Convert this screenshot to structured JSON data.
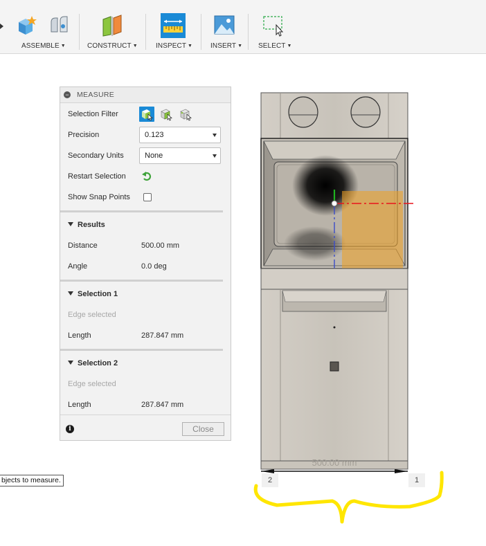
{
  "toolbar": {
    "groups": [
      {
        "label": "ASSEMBLE",
        "icon": "assemble-icon"
      },
      {
        "label": "CONSTRUCT",
        "icon": "construct-plane-icon"
      },
      {
        "label": "INSPECT",
        "icon": "measure-ruler-icon",
        "active": true
      },
      {
        "label": "INSERT",
        "icon": "insert-image-icon"
      },
      {
        "label": "SELECT",
        "icon": "select-window-icon"
      }
    ]
  },
  "measure": {
    "title": "MEASURE",
    "selection_filter_label": "Selection Filter",
    "precision_label": "Precision",
    "precision_value": "0.123",
    "secondary_units_label": "Secondary Units",
    "secondary_units_value": "None",
    "restart_selection_label": "Restart Selection",
    "show_snap_points_label": "Show Snap Points",
    "results": {
      "title": "Results",
      "distance_label": "Distance",
      "distance_value": "500.00 mm",
      "angle_label": "Angle",
      "angle_value": "0.0 deg"
    },
    "selection1": {
      "title": "Selection 1",
      "status": "Edge selected",
      "length_label": "Length",
      "length_value": "287.847 mm"
    },
    "selection2": {
      "title": "Selection 2",
      "status": "Edge selected",
      "length_label": "Length",
      "length_value": "287.847 mm"
    },
    "close_label": "Close"
  },
  "tooltip": "bjects to measure.",
  "viewport": {
    "dimension_text": "500.00 mm",
    "point_labels": [
      "2",
      "1"
    ],
    "colors": {
      "annotation": "#ffe600",
      "x_axis": "#e8141b",
      "y_axis": "#1fb31f",
      "z_axis": "#3b4cc8",
      "highlight": "#f0a020"
    }
  }
}
